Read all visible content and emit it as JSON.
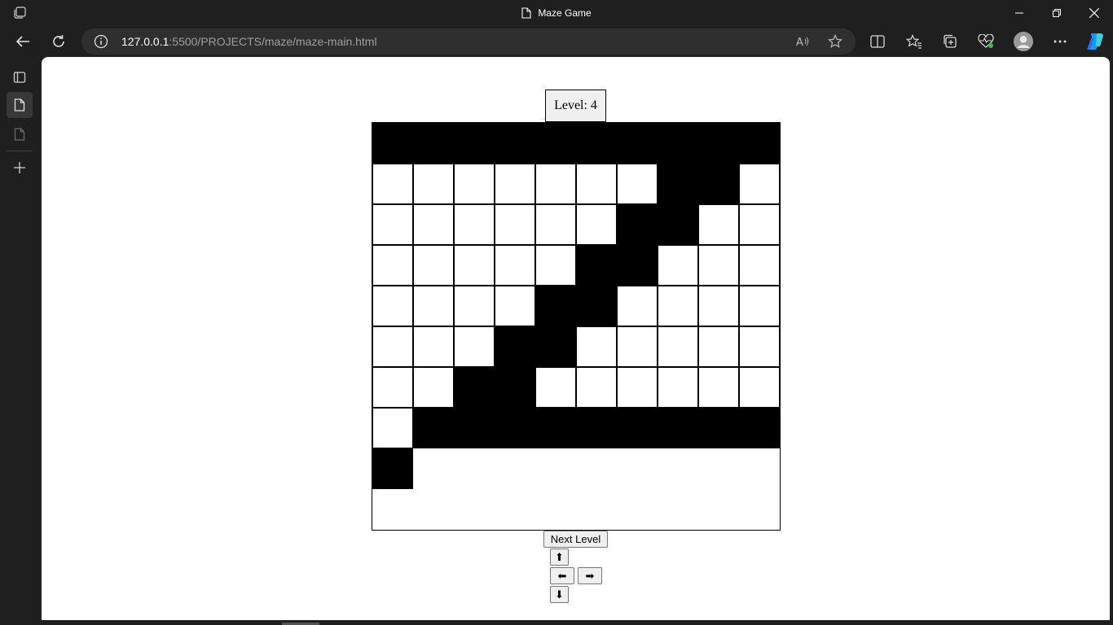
{
  "window": {
    "title": "Maze Game",
    "controls": [
      "minimize-icon",
      "restore-icon",
      "close-icon"
    ]
  },
  "address_bar": {
    "url_host": "127.0.0.1",
    "url_rest": ":5500/PROJECTS/maze/maze-main.html"
  },
  "toolbar_icons": [
    "back-icon",
    "refresh-icon",
    "info-icon",
    "read-aloud-icon",
    "favorite-star-icon",
    "split-screen-icon",
    "favorites-icon",
    "collections-icon",
    "browser-essentials-icon",
    "profile-avatar",
    "more-icon",
    "copilot-icon"
  ],
  "sidebar_icons": [
    "tab-actions-icon",
    "page-icon",
    "page-icon",
    "add-icon"
  ],
  "game": {
    "level_label": "Level: 4",
    "next_level_label": "Next Level",
    "up_label": "⬆",
    "left_label": "⬅",
    "right_label": "➡",
    "down_label": "⬇"
  },
  "maze": {
    "rows": 10,
    "cols": 10,
    "legend": {
      "1": "wall",
      "0": "open",
      "2": "empty"
    },
    "grid": [
      [
        1,
        1,
        1,
        1,
        1,
        1,
        1,
        1,
        1,
        1
      ],
      [
        0,
        0,
        0,
        0,
        0,
        0,
        0,
        1,
        1,
        0
      ],
      [
        0,
        0,
        0,
        0,
        0,
        0,
        1,
        1,
        0,
        0
      ],
      [
        0,
        0,
        0,
        0,
        0,
        1,
        1,
        0,
        0,
        0
      ],
      [
        0,
        0,
        0,
        0,
        1,
        1,
        0,
        0,
        0,
        0
      ],
      [
        0,
        0,
        0,
        1,
        1,
        0,
        0,
        0,
        0,
        0
      ],
      [
        0,
        0,
        1,
        1,
        0,
        0,
        0,
        0,
        0,
        0
      ],
      [
        0,
        1,
        1,
        1,
        1,
        1,
        1,
        1,
        1,
        1
      ],
      [
        1,
        2,
        2,
        2,
        2,
        2,
        2,
        2,
        2,
        2
      ],
      [
        2,
        2,
        2,
        2,
        2,
        2,
        2,
        2,
        2,
        2
      ]
    ]
  },
  "colors": {
    "browser_chrome": "#1f1f1f",
    "address_bar": "#2f2f2f",
    "wall": "#000000",
    "open": "#ffffff"
  }
}
